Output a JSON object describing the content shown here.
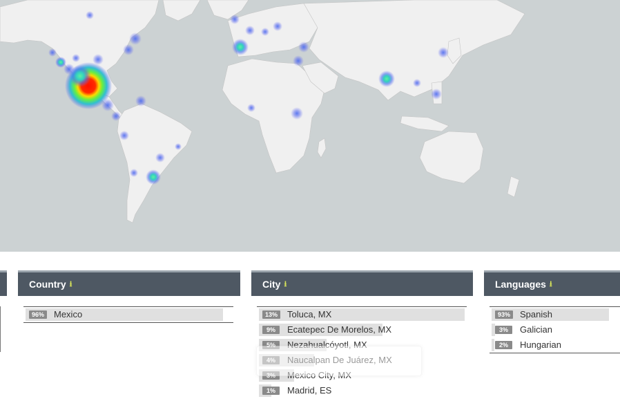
{
  "panels": {
    "country": {
      "title": "Country",
      "rows": [
        {
          "pct": "96%",
          "value": 96,
          "label": "Mexico"
        }
      ]
    },
    "city": {
      "title": "City",
      "rows": [
        {
          "pct": "13%",
          "value": 100,
          "label": "Toluca, MX"
        },
        {
          "pct": "9%",
          "value": 60,
          "label": "Ecatepec De Morelos, MX"
        },
        {
          "pct": "5%",
          "value": 33,
          "label": "Nezahualcóyotl, MX"
        },
        {
          "pct": "4%",
          "value": 27,
          "label": "Naucalpan De Juárez, MX"
        },
        {
          "pct": "3%",
          "value": 17,
          "label": "Mexico City, MX"
        },
        {
          "pct": "1%",
          "value": 6,
          "label": "Madrid, ES"
        }
      ]
    },
    "languages": {
      "title": "Languages",
      "rows": [
        {
          "pct": "93%",
          "value": 93,
          "label": "Spanish"
        },
        {
          "pct": "3%",
          "value": 3,
          "label": "Galician"
        },
        {
          "pct": "2%",
          "value": 2,
          "label": "Hungarian"
        }
      ]
    }
  },
  "icons": {
    "download": "download-icon"
  },
  "colors": {
    "header": "#4e5863",
    "accent": "#d8e45a",
    "map_water": "#ccd2d3",
    "map_land": "#f0f0f0"
  }
}
